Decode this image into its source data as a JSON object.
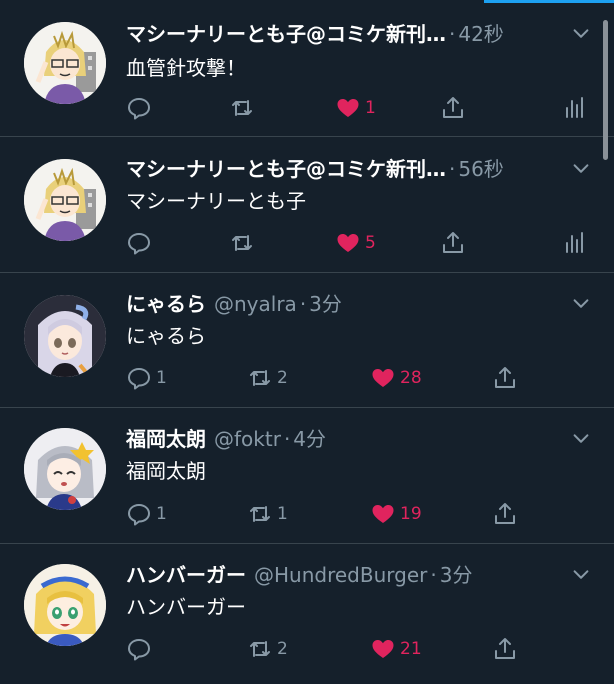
{
  "accent_color": "#1da1f2",
  "like_color": "#e0245e",
  "tweets": [
    {
      "name": "マシーナリーとも子@コミケ新刊",
      "ellipsis": "…",
      "handle": "",
      "time": "42秒",
      "text": "血管針攻撃！",
      "replies": "",
      "retweets": "",
      "likes": "1",
      "liked": true,
      "avatar": "tomoko-avatar"
    },
    {
      "name": "マシーナリーとも子@コミケ新刊",
      "ellipsis": "…",
      "handle": "",
      "time": "56秒",
      "text": "マシーナリーとも子",
      "replies": "",
      "retweets": "",
      "likes": "5",
      "liked": true,
      "avatar": "tomoko-avatar"
    },
    {
      "name": "にゃるら",
      "ellipsis": "",
      "handle": "@nyalra",
      "time": "3分",
      "text": "にゃるら",
      "replies": "1",
      "retweets": "2",
      "likes": "28",
      "liked": true,
      "avatar": "nyalra-avatar"
    },
    {
      "name": "福岡太朗",
      "ellipsis": "",
      "handle": "@foktr",
      "time": "4分",
      "text": "福岡太朗",
      "replies": "1",
      "retweets": "1",
      "likes": "19",
      "liked": true,
      "avatar": "foktr-avatar"
    },
    {
      "name": "ハンバーガー",
      "ellipsis": "",
      "handle": "@HundredBurger",
      "time": "3分",
      "text": "ハンバーガー",
      "replies": "",
      "retweets": "2",
      "likes": "21",
      "liked": true,
      "avatar": "burger-avatar"
    }
  ],
  "meta_separator": "·"
}
